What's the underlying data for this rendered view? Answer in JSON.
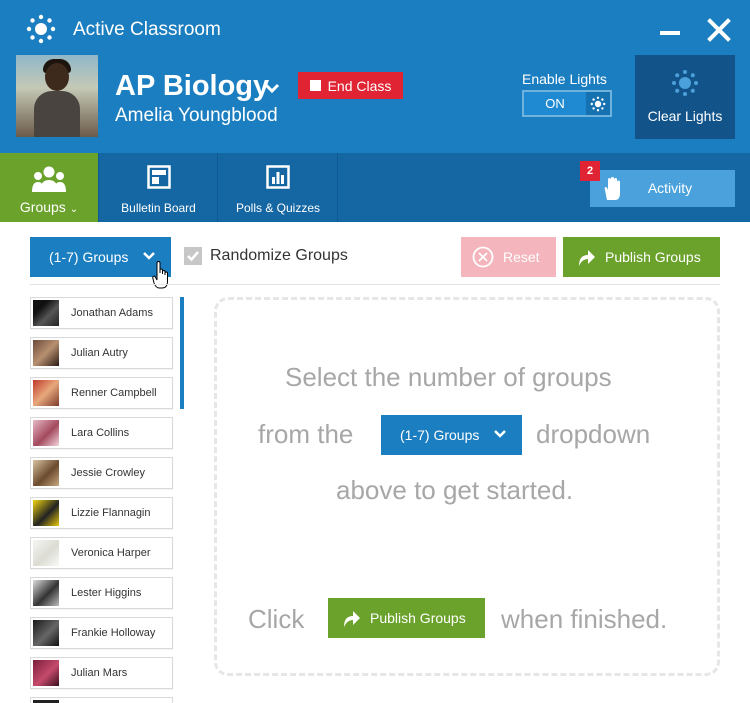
{
  "header": {
    "app_title": "Active Classroom",
    "class_name": "AP Biology",
    "teacher_name": "Amelia Youngblood",
    "end_class_label": "End Class",
    "enable_lights_label": "Enable Lights",
    "lights_toggle_state": "ON",
    "clear_lights_label": "Clear Lights"
  },
  "nav": {
    "tabs": [
      {
        "label": "Groups",
        "active": true,
        "icon": "users-icon"
      },
      {
        "label": "Bulletin Board",
        "active": false,
        "icon": "bulletin-board-icon"
      },
      {
        "label": "Polls & Quizzes",
        "active": false,
        "icon": "bar-chart-icon"
      }
    ],
    "activity_label": "Activity",
    "activity_badge": "2"
  },
  "toolbar": {
    "groups_dropdown": "(1-7) Groups",
    "randomize_label": "Randomize Groups",
    "randomize_checked": true,
    "reset_label": "Reset",
    "publish_label": "Publish Groups"
  },
  "students": [
    {
      "name": "Jonathan Adams"
    },
    {
      "name": "Julian Autry"
    },
    {
      "name": "Renner Campbell"
    },
    {
      "name": "Lara Collins"
    },
    {
      "name": "Jessie Crowley"
    },
    {
      "name": "Lizzie Flannagin"
    },
    {
      "name": "Veronica Harper"
    },
    {
      "name": "Lester Higgins"
    },
    {
      "name": "Frankie Holloway"
    },
    {
      "name": "Julian Mars"
    }
  ],
  "instructions": {
    "line1": "Select the number of groups",
    "line2_before": "from the",
    "line2_dropdown": "(1-7) Groups",
    "line2_after": "dropdown",
    "line3": "above to get started.",
    "line4_before": "Click",
    "line4_button": "Publish Groups",
    "line4_after": "when finished."
  },
  "colors": {
    "header_blue": "#1b7ec0",
    "nav_blue": "#1567a4",
    "green": "#6ba22c",
    "red": "#e02434",
    "dark_blue": "#12548a",
    "light_blue": "#4aa1db",
    "reset_pink": "#f4b5bc"
  }
}
